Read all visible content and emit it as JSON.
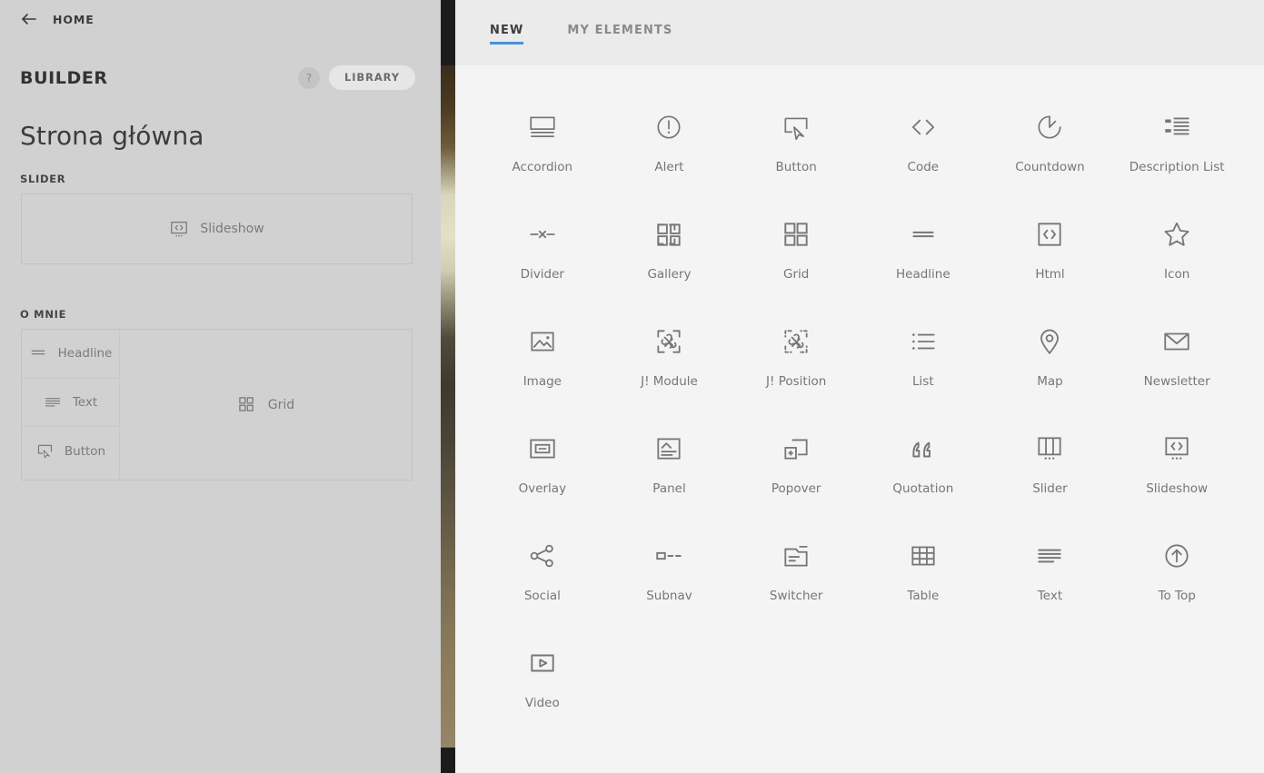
{
  "sidebar": {
    "back": {
      "label": "HOME",
      "icon": "arrow-left-icon"
    },
    "builder_title": "BUILDER",
    "help_label": "?",
    "library_label": "LIBRARY",
    "page_title": "Strona główna",
    "sections": [
      {
        "label": "SLIDER",
        "blocks": [
          {
            "label": "Slideshow",
            "icon": "slideshow-icon"
          }
        ]
      },
      {
        "label": "O MNIE",
        "blocks": [
          {
            "label": "Headline",
            "icon": "headline-icon"
          },
          {
            "label": "Text",
            "icon": "text-icon"
          },
          {
            "label": "Button",
            "icon": "button-icon"
          },
          {
            "label": "Grid",
            "icon": "grid-icon"
          }
        ]
      }
    ]
  },
  "panel": {
    "tabs": [
      {
        "label": "NEW",
        "active": true
      },
      {
        "label": "MY ELEMENTS",
        "active": false
      }
    ],
    "elements": [
      {
        "label": "Accordion",
        "icon": "accordion-icon"
      },
      {
        "label": "Alert",
        "icon": "alert-icon"
      },
      {
        "label": "Button",
        "icon": "button-icon"
      },
      {
        "label": "Code",
        "icon": "code-icon"
      },
      {
        "label": "Countdown",
        "icon": "countdown-icon"
      },
      {
        "label": "Description List",
        "icon": "description-list-icon"
      },
      {
        "label": "Divider",
        "icon": "divider-icon"
      },
      {
        "label": "Gallery",
        "icon": "gallery-icon"
      },
      {
        "label": "Grid",
        "icon": "grid-icon"
      },
      {
        "label": "Headline",
        "icon": "headline-icon"
      },
      {
        "label": "Html",
        "icon": "html-icon"
      },
      {
        "label": "Icon",
        "icon": "star-icon"
      },
      {
        "label": "Image",
        "icon": "image-icon"
      },
      {
        "label": "J! Module",
        "icon": "joomla-module-icon"
      },
      {
        "label": "J! Position",
        "icon": "joomla-position-icon"
      },
      {
        "label": "List",
        "icon": "list-icon"
      },
      {
        "label": "Map",
        "icon": "map-pin-icon"
      },
      {
        "label": "Newsletter",
        "icon": "envelope-icon"
      },
      {
        "label": "Overlay",
        "icon": "overlay-icon"
      },
      {
        "label": "Panel",
        "icon": "panel-icon"
      },
      {
        "label": "Popover",
        "icon": "popover-icon"
      },
      {
        "label": "Quotation",
        "icon": "quotation-icon"
      },
      {
        "label": "Slider",
        "icon": "slider-icon"
      },
      {
        "label": "Slideshow",
        "icon": "slideshow-icon"
      },
      {
        "label": "Social",
        "icon": "social-share-icon"
      },
      {
        "label": "Subnav",
        "icon": "subnav-icon"
      },
      {
        "label": "Switcher",
        "icon": "switcher-icon"
      },
      {
        "label": "Table",
        "icon": "table-icon"
      },
      {
        "label": "Text",
        "icon": "text-icon"
      },
      {
        "label": "To Top",
        "icon": "to-top-icon"
      },
      {
        "label": "Video",
        "icon": "video-icon"
      }
    ]
  },
  "colors": {
    "sidebar_bg": "#d1d1d1",
    "panel_bg": "#f4f4f4",
    "panel_header_bg": "#ebebeb",
    "tab_active_underline": "#4a90d9",
    "icon_stroke": "#767676",
    "label_text": "#767676"
  }
}
